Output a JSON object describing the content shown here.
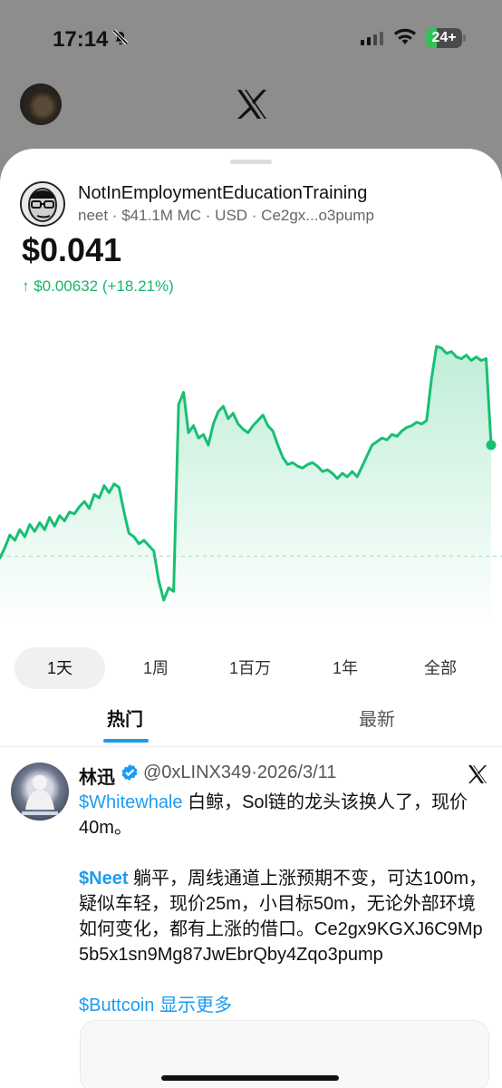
{
  "status_bar": {
    "time": "17:14",
    "battery": "24+"
  },
  "colors": {
    "accent": "#1d9bf0",
    "positive": "#18b46b",
    "chart_line": "#18bf74",
    "chart_fill": "#dff6ea"
  },
  "token": {
    "name": "NotInEmploymentEducationTraining",
    "meta": "neet · $41.1M MC · USD · Ce2gx...o3pump",
    "price": "$0.041",
    "change": "↑ $0.00632 (+18.21%)"
  },
  "chart_data": {
    "type": "line",
    "x": [
      0,
      1,
      2,
      3,
      4,
      5,
      6,
      7,
      8,
      9,
      10,
      11,
      12,
      13,
      14,
      15,
      16,
      17,
      18,
      19,
      20,
      21,
      22,
      23,
      24,
      25,
      26,
      27,
      28,
      29,
      30,
      31,
      32,
      33,
      34,
      35,
      36,
      37,
      38,
      39,
      40,
      41,
      42,
      43,
      44,
      45,
      46,
      47,
      48,
      49,
      50,
      51,
      52,
      53,
      54,
      55,
      56,
      57,
      58,
      59,
      60,
      61,
      62,
      63,
      64,
      65,
      66,
      67,
      68,
      69,
      70,
      71,
      72,
      73,
      74,
      75,
      76,
      77,
      78,
      79,
      80,
      81,
      82,
      83,
      84,
      85,
      86,
      87,
      88,
      89,
      90,
      91,
      92,
      93,
      94,
      95,
      96,
      97,
      98,
      99
    ],
    "y": [
      0.0346,
      0.0352,
      0.0359,
      0.0356,
      0.0362,
      0.0358,
      0.0365,
      0.0361,
      0.0366,
      0.0362,
      0.0369,
      0.0364,
      0.037,
      0.0367,
      0.0372,
      0.0371,
      0.0375,
      0.0378,
      0.0374,
      0.0382,
      0.038,
      0.0387,
      0.0383,
      0.0388,
      0.0386,
      0.0372,
      0.036,
      0.0358,
      0.0354,
      0.0356,
      0.0353,
      0.035,
      0.0333,
      0.0322,
      0.0329,
      0.0327,
      0.0433,
      0.044,
      0.0417,
      0.0421,
      0.0414,
      0.0416,
      0.041,
      0.0422,
      0.0429,
      0.0432,
      0.0425,
      0.0428,
      0.0422,
      0.0419,
      0.0417,
      0.0421,
      0.0424,
      0.0427,
      0.0421,
      0.0418,
      0.041,
      0.0403,
      0.0399,
      0.04,
      0.0398,
      0.0397,
      0.0399,
      0.04,
      0.0398,
      0.0395,
      0.0396,
      0.0394,
      0.0391,
      0.0394,
      0.0392,
      0.0395,
      0.0392,
      0.0398,
      0.0404,
      0.041,
      0.0412,
      0.0414,
      0.0413,
      0.0416,
      0.0415,
      0.0418,
      0.042,
      0.0421,
      0.0423,
      0.0422,
      0.0424,
      0.0448,
      0.0466,
      0.0465,
      0.0462,
      0.0463,
      0.046,
      0.0459,
      0.0461,
      0.0458,
      0.046,
      0.0458,
      0.0459,
      0.041
    ],
    "reference_y": 0.0347,
    "grid": false,
    "title": "",
    "xlabel": "",
    "ylabel": ""
  },
  "ranges": [
    {
      "label": "1天",
      "active": true
    },
    {
      "label": "1周",
      "active": false
    },
    {
      "label": "1百万",
      "active": false
    },
    {
      "label": "1年",
      "active": false
    },
    {
      "label": "全部",
      "active": false
    }
  ],
  "tabs": [
    {
      "label": "热门",
      "active": true
    },
    {
      "label": "最新",
      "active": false
    }
  ],
  "tweet": {
    "name": "林迅",
    "handle": "@0xLINX349·2026/3/11",
    "p1_cashtag": "$Whitewhale",
    "p1_text": " 白鲸，Sol链的龙头该换人了，现价40m。",
    "p2_cashtag": "$Neet",
    "p2_text": " 躺平，周线通道上涨预期不变，可达100m，疑似车轻，现价25m，小目标50m，无论外部环境如何变化，都有上涨的借口。Ce2gx9KGXJ6C9Mp5b5x1sn9Mg87JwEbrQby4Zqo3pump",
    "p3_cashtag": "$Buttcoin",
    "p3_more": " 显示更多"
  }
}
